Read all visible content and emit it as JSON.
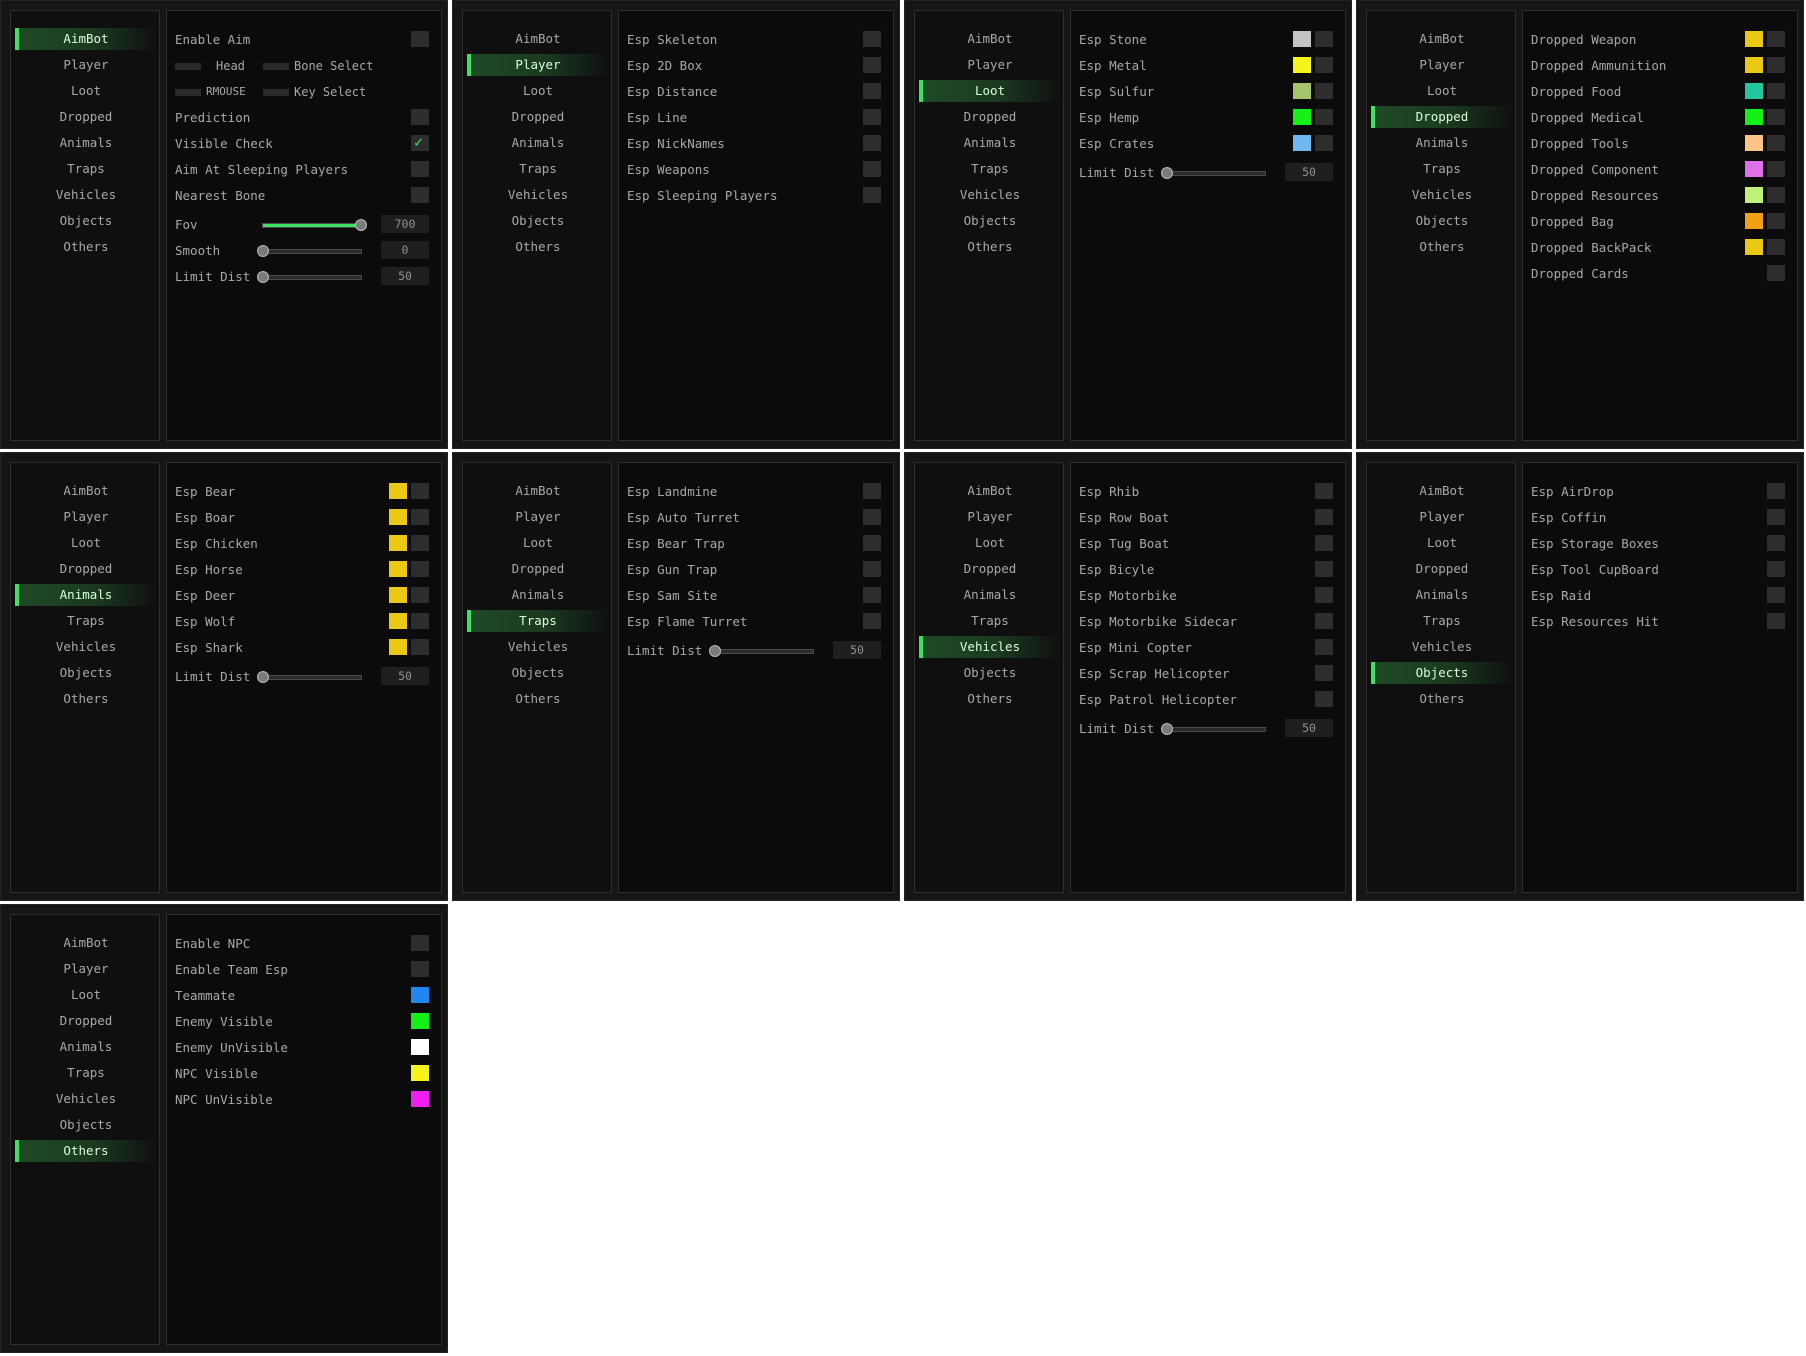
{
  "nav_items": [
    "AimBot",
    "Player",
    "Loot",
    "Dropped",
    "Animals",
    "Traps",
    "Vehicles",
    "Objects",
    "Others"
  ],
  "panels": [
    {
      "id": "aimbot",
      "active_index": 0,
      "aim": {
        "enable_aim": "Enable Aim",
        "head_key": "Head",
        "bone_select": "Bone Select",
        "rmouse_key": "RMOUSE",
        "key_select": "Key Select",
        "prediction": "Prediction",
        "visible_check": "Visible Check",
        "visible_check_on": true,
        "aim_sleeping": "Aim At Sleeping Players",
        "nearest_bone": "Nearest Bone"
      },
      "sliders": [
        {
          "label": "Fov",
          "value": "700",
          "fraction": 1.0
        },
        {
          "label": "Smooth",
          "value": "0",
          "fraction": 0.0
        },
        {
          "label": "Limit Dist",
          "value": "50",
          "fraction": 0.0
        }
      ]
    },
    {
      "id": "player",
      "active_index": 1,
      "rows": [
        {
          "label": "Esp Skeleton"
        },
        {
          "label": "Esp 2D Box"
        },
        {
          "label": "Esp Distance"
        },
        {
          "label": "Esp Line"
        },
        {
          "label": "Esp NickNames"
        },
        {
          "label": "Esp Weapons"
        },
        {
          "label": "Esp Sleeping Players"
        }
      ]
    },
    {
      "id": "loot",
      "active_index": 2,
      "rows": [
        {
          "label": "Esp Stone",
          "color": "#c4c4c4"
        },
        {
          "label": "Esp Metal",
          "color": "#f5f51c"
        },
        {
          "label": "Esp Sulfur",
          "color": "#a5c46b"
        },
        {
          "label": "Esp Hemp",
          "color": "#16f016"
        },
        {
          "label": "Esp Crates",
          "color": "#72b8f0"
        }
      ],
      "slider": {
        "label": "Limit Dist",
        "value": "50",
        "fraction": 0.0
      }
    },
    {
      "id": "dropped",
      "active_index": 3,
      "rows": [
        {
          "label": "Dropped Weapon",
          "color": "#eac814"
        },
        {
          "label": "Dropped Ammunition",
          "color": "#eac814"
        },
        {
          "label": "Dropped Food",
          "color": "#23c7a0"
        },
        {
          "label": "Dropped Medical",
          "color": "#16f016"
        },
        {
          "label": "Dropped Tools",
          "color": "#fcc484"
        },
        {
          "label": "Dropped Component",
          "color": "#e070e8"
        },
        {
          "label": "Dropped Resources",
          "color": "#bff277"
        },
        {
          "label": "Dropped Bag",
          "color": "#f4a016"
        },
        {
          "label": "Dropped BackPack",
          "color": "#eac814"
        },
        {
          "label": "Dropped Cards"
        }
      ]
    },
    {
      "id": "animals",
      "active_index": 4,
      "rows": [
        {
          "label": "Esp Bear",
          "color": "#eac814"
        },
        {
          "label": "Esp Boar",
          "color": "#eac814"
        },
        {
          "label": "Esp Chicken",
          "color": "#eac814"
        },
        {
          "label": "Esp Horse",
          "color": "#eac814"
        },
        {
          "label": "Esp Deer",
          "color": "#eac814"
        },
        {
          "label": "Esp Wolf",
          "color": "#eac814"
        },
        {
          "label": "Esp Shark",
          "color": "#eac814"
        }
      ],
      "slider": {
        "label": "Limit Dist",
        "value": "50",
        "fraction": 0.0
      }
    },
    {
      "id": "traps",
      "active_index": 5,
      "rows": [
        {
          "label": "Esp Landmine"
        },
        {
          "label": "Esp Auto Turret"
        },
        {
          "label": "Esp Bear Trap"
        },
        {
          "label": "Esp Gun Trap"
        },
        {
          "label": "Esp Sam Site"
        },
        {
          "label": "Esp Flame Turret"
        }
      ],
      "slider": {
        "label": "Limit Dist",
        "value": "50",
        "fraction": 0.0
      }
    },
    {
      "id": "vehicles",
      "active_index": 6,
      "rows": [
        {
          "label": "Esp Rhib"
        },
        {
          "label": "Esp Row Boat"
        },
        {
          "label": "Esp Tug Boat"
        },
        {
          "label": "Esp Bicyle"
        },
        {
          "label": "Esp Motorbike"
        },
        {
          "label": "Esp Motorbike Sidecar"
        },
        {
          "label": "Esp Mini Copter"
        },
        {
          "label": "Esp Scrap Helicopter"
        },
        {
          "label": "Esp Patrol Helicopter"
        }
      ],
      "slider": {
        "label": "Limit Dist",
        "value": "50",
        "fraction": 0.0
      }
    },
    {
      "id": "objects",
      "active_index": 7,
      "rows": [
        {
          "label": "Esp AirDrop"
        },
        {
          "label": "Esp Coffin"
        },
        {
          "label": "Esp Storage Boxes"
        },
        {
          "label": "Esp Tool CupBoard"
        },
        {
          "label": "Esp Raid"
        },
        {
          "label": "Esp Resources Hit"
        }
      ]
    },
    {
      "id": "others",
      "active_index": 8,
      "rows": [
        {
          "label": "Enable NPC",
          "kind": "checkbox"
        },
        {
          "label": "Enable Team Esp",
          "kind": "checkbox"
        },
        {
          "label": "Teammate",
          "kind": "color",
          "color": "#1e88f0"
        },
        {
          "label": "Enemy Visible",
          "kind": "color",
          "color": "#14f014"
        },
        {
          "label": "Enemy UnVisible",
          "kind": "color",
          "color": "#ffffff"
        },
        {
          "label": "NPC Visible",
          "kind": "color",
          "color": "#f5f51c"
        },
        {
          "label": "NPC UnVisible",
          "kind": "color",
          "color": "#f01ef0"
        }
      ]
    }
  ]
}
